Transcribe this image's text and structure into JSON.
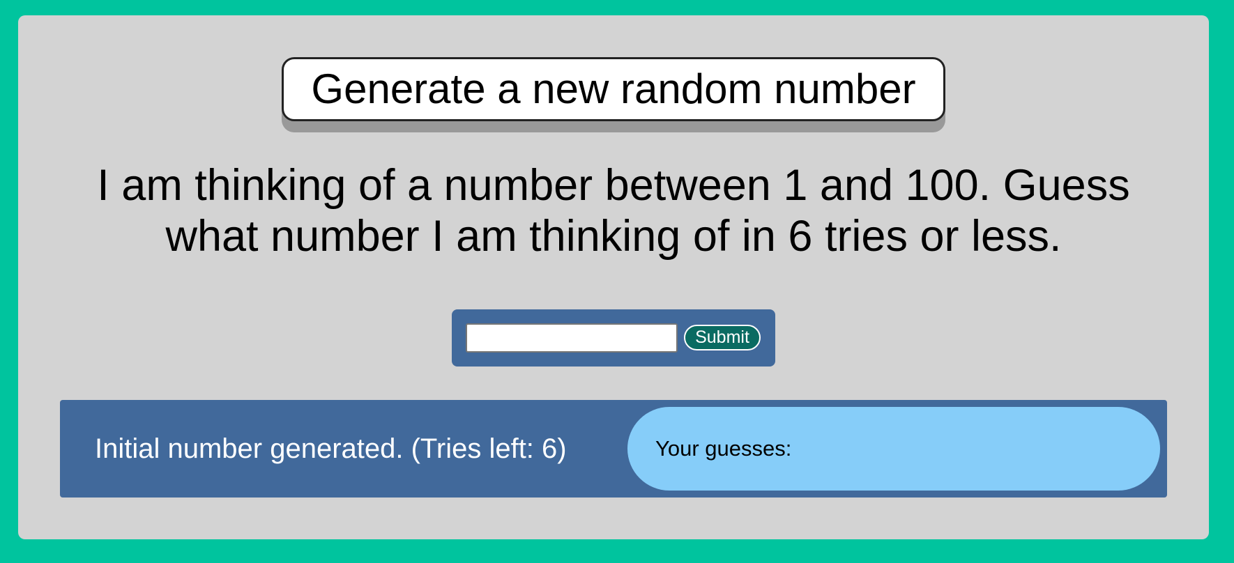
{
  "header": {
    "generate_label": "Generate a new random number"
  },
  "prompt": {
    "text": "I am thinking of a number between 1 and 100. Guess what number I am thinking of in 6 tries or less."
  },
  "form": {
    "input_value": "",
    "input_placeholder": "",
    "submit_label": "Submit"
  },
  "results": {
    "status_text": "Initial number generated. (Tries left: 6)",
    "guesses_label": "Your guesses:",
    "guesses": ""
  },
  "colors": {
    "page_background": "#00c49e",
    "panel_background": "#d3d3d3",
    "bar_background": "#41699b",
    "submit_background": "#0a6b62",
    "guesses_background": "#86cdf9"
  }
}
